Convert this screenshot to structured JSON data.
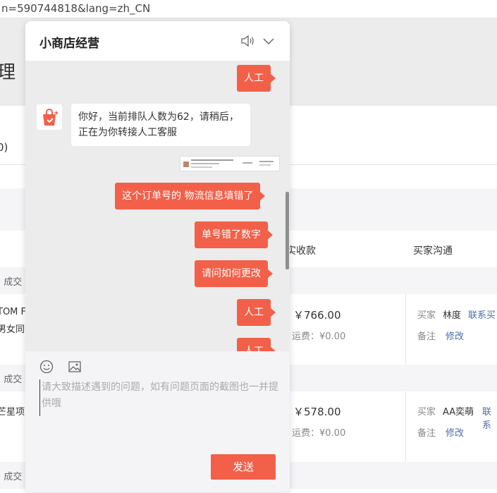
{
  "browser": {
    "url_fragment": "n=590744818&lang=zh_CN"
  },
  "page": {
    "title_fragment": "理",
    "count_fragment": "0)",
    "columns": {
      "received": "实收款",
      "buyer_chat": "买家沟通"
    },
    "orders": [
      {
        "status_fragment": ")  成交",
        "product_line1": "TOM F",
        "product_line2": "男女同",
        "price": "￥766.00",
        "shipping": "运费：¥0.00",
        "buyer_label": "买家",
        "buyer_name": "林度",
        "contact_link": "联系买",
        "note_label": "备注",
        "edit_link": "修改"
      },
      {
        "status_fragment": ")  成交",
        "product_line1": "芒星项",
        "product_line2": "",
        "price": "￥578.00",
        "shipping": "运费：¥0.00",
        "buyer_label": "买家",
        "buyer_name": "AA奕萌",
        "contact_link": "联系",
        "note_label": "备注",
        "edit_link": "修改"
      },
      {
        "status_fragment": ")  成交"
      }
    ]
  },
  "chat": {
    "title": "小商店经营",
    "messages": [
      {
        "from": "user",
        "text": "人工"
      },
      {
        "from": "bot",
        "text": "你好，当前排队人数为62，请稍后，正在为你转接人工客服"
      },
      {
        "from": "user",
        "type": "image"
      },
      {
        "from": "user",
        "text": "这个订单号的  物流信息填错了"
      },
      {
        "from": "user",
        "text": "单号错了数字"
      },
      {
        "from": "user",
        "text": "请问如何更改"
      },
      {
        "from": "user",
        "text": "人工"
      },
      {
        "from": "user",
        "text": "人工"
      }
    ],
    "input_placeholder": "请大致描述遇到的问题，如有问题页面的截图也一并提供哦",
    "send_label": "发送",
    "colors": {
      "accent": "#f26049",
      "message_bg": "#ececec"
    }
  }
}
